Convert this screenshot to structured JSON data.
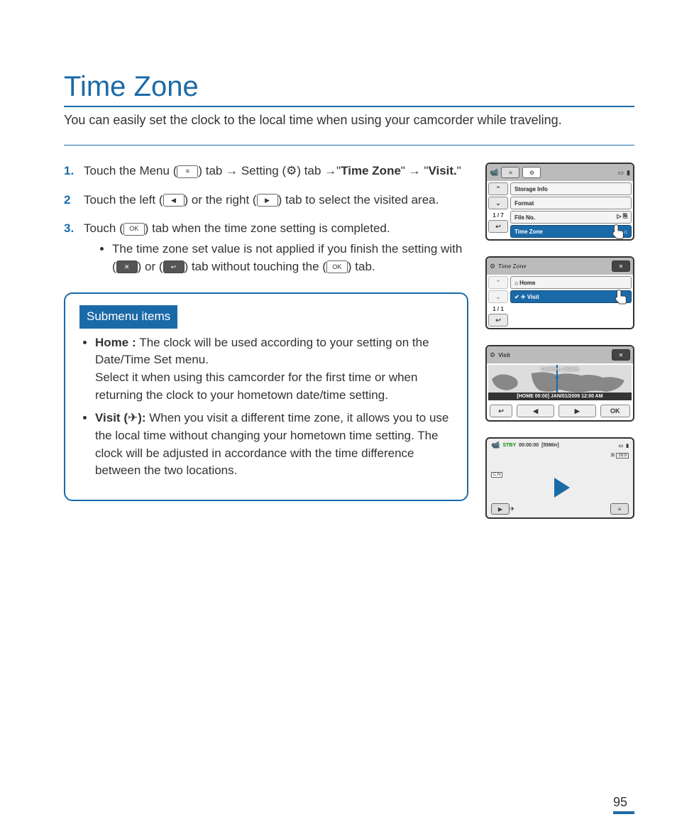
{
  "title": "Time Zone",
  "intro": "You can easily set the clock to the local time when using your camcorder while traveling.",
  "steps": {
    "s1_a": "Touch the Menu (",
    "s1_b": ") tab ",
    "s1_c": " Setting (",
    "s1_d": ") tab ",
    "s1_e": "\"",
    "s1_f": "Time Zone",
    "s1_g": "\" ",
    "s1_h": " \"",
    "s1_i": "Visit.",
    "s1_j": "\"",
    "s2_a": "Touch the left (",
    "s2_b": ") or the right (",
    "s2_c": ") tab to select the visited area.",
    "s3_a": "Touch (",
    "s3_b": ") tab when the time zone setting is completed.",
    "s3_bullet_a": "The time zone set value is not applied if you finish the setting with (",
    "s3_bullet_b": ") or (",
    "s3_bullet_c": ") tab without touching the (",
    "s3_bullet_d": ") tab."
  },
  "nums": {
    "n1": "1.",
    "n2": "2",
    "n3": "3."
  },
  "icons": {
    "menu": "≡",
    "gear": "⚙",
    "left": "◀",
    "right": "▶",
    "ok": "OK",
    "x": "✕",
    "return": "↩",
    "arrow": "→"
  },
  "submenu": {
    "label": "Submenu items",
    "home_title": "Home : ",
    "home_body": "The clock will be used according to your setting on the Date/Time Set menu.\nSelect it when using this camcorder for the first time or when returning the clock to your hometown date/time setting.",
    "visit_title": "Visit (",
    "visit_title2": "):",
    "visit_body": " When you visit a different time zone, it allows you to use the local time without changing your hometown time setting. The clock will be adjusted in accordance with the time difference between the two locations."
  },
  "screen1": {
    "items": [
      "Storage Info",
      "Format",
      "File No.",
      "Time Zone"
    ],
    "page": "1 / 7"
  },
  "screen2": {
    "title": "Time Zone",
    "items": [
      "Home",
      "Visit"
    ],
    "page": "1 / 1"
  },
  "screen3": {
    "title": "Visit",
    "city": "London, Lisbon",
    "bar": "[HOME 00:00] JAN/01/2009 12:00 AM",
    "ok": "OK"
  },
  "screen4": {
    "stby": "STBY",
    "time": "00:00:00",
    "remain": "[55Min]",
    "cn": "C.N"
  },
  "pagenum": "95"
}
